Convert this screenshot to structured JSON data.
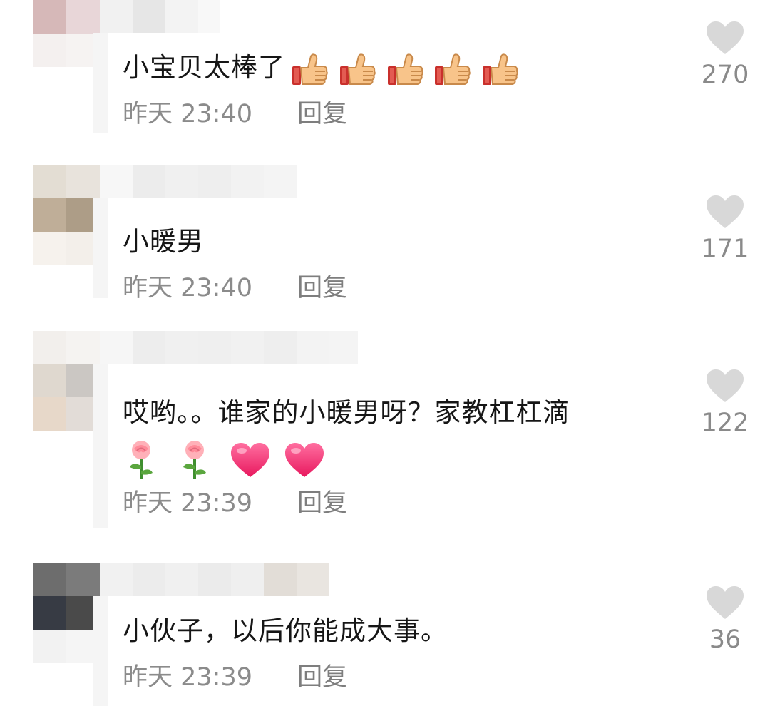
{
  "comments": [
    {
      "text": "小宝贝太棒了",
      "emoji": [
        "thumbs-up-icon",
        "thumbs-up-icon",
        "thumbs-up-icon",
        "thumbs-up-icon",
        "thumbs-up-icon"
      ],
      "time": "昨天 23:40",
      "reply_label": "回复",
      "likes": "270"
    },
    {
      "text": "小暖男",
      "emoji": [],
      "time": "昨天 23:40",
      "reply_label": "回复",
      "likes": "171"
    },
    {
      "text": "哎哟。。谁家的小暖男呀？家教杠杠滴",
      "emoji": [
        "rose-icon",
        "rose-icon",
        "heart-icon",
        "heart-icon"
      ],
      "time": "昨天 23:39",
      "reply_label": "回复",
      "likes": "122"
    },
    {
      "text": "小伙子，以后你能成大事。",
      "emoji": [],
      "time": "昨天 23:39",
      "reply_label": "回复",
      "likes": "36"
    }
  ],
  "colors": {
    "like_heart": "#d8d8d8",
    "meta_text": "#8b8b8b",
    "body_text": "#161616",
    "pink_heart": "#ff3d7f"
  }
}
